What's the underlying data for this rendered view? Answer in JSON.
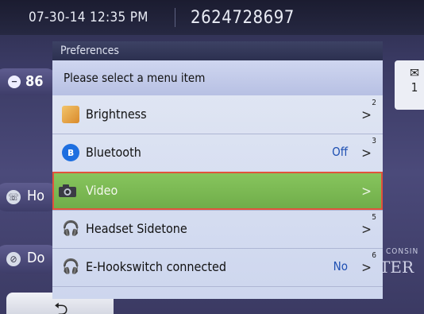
{
  "status_bar": {
    "datetime": "07-30-14 12:35 PM",
    "phone_number": "2624728697"
  },
  "background": {
    "status_value": "86",
    "home_label": "Ho",
    "dnd_label": "Do",
    "message_count": "1",
    "watermark_line1": "CONSIN",
    "watermark_line2": "TER",
    "back_symbol": "⮌"
  },
  "dialog": {
    "title": "Preferences",
    "prompt": "Please select a menu item",
    "items": [
      {
        "label": "Brightness",
        "value": "",
        "number": "2",
        "icon": "brightness-icon",
        "selected": false
      },
      {
        "label": "Bluetooth",
        "value": "Off",
        "number": "3",
        "icon": "bluetooth-icon",
        "selected": false
      },
      {
        "label": "Video",
        "value": "",
        "number": "",
        "icon": "camera-icon",
        "selected": true
      },
      {
        "label": "Headset Sidetone",
        "value": "",
        "number": "5",
        "icon": "headset-icon",
        "selected": false
      },
      {
        "label": "E-Hookswitch connected",
        "value": "No",
        "number": "6",
        "icon": "headset-icon",
        "selected": false
      }
    ]
  },
  "colors": {
    "selected_row": "#7cba53",
    "selection_border": "#e1533c",
    "value_text": "#1e4fb2"
  }
}
